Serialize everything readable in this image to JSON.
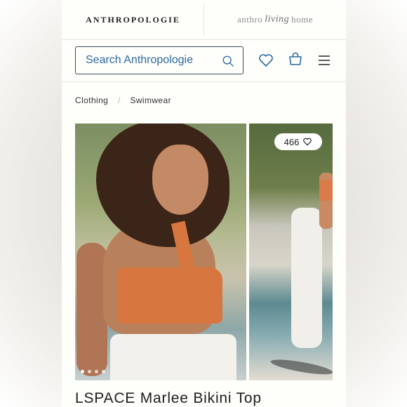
{
  "header": {
    "brand": "ANTHROPOLOGIE",
    "living_prefix": "anthro",
    "living_script": "living",
    "living_suffix": "home"
  },
  "search": {
    "placeholder": "Search Anthropologie"
  },
  "icons": {
    "search": "search-icon",
    "wishlist": "heart-icon",
    "bag": "shopping-bag-icon",
    "menu": "hamburger-menu-icon"
  },
  "breadcrumb": {
    "items": [
      "Clothing",
      "Swimwear"
    ]
  },
  "gallery": {
    "likes_count": "466",
    "carousel_dots": 4,
    "active_dot": 0
  },
  "product": {
    "title": "LSPACE Marlee Bikini Top"
  },
  "colors": {
    "link_blue": "#2c6aa0",
    "text_dark": "#1d1d1d",
    "border": "#e4e2dd"
  }
}
